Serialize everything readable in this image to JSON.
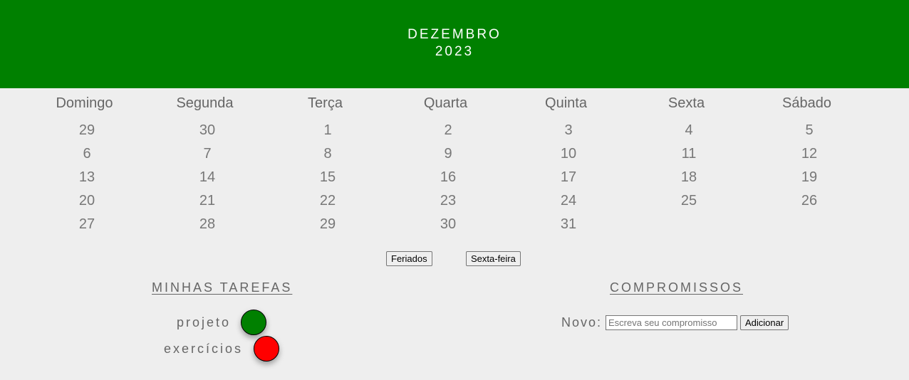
{
  "header": {
    "month": "DEZEMBRO",
    "year": "2023",
    "color": "#008000"
  },
  "calendar": {
    "weekdays": [
      "Domingo",
      "Segunda",
      "Terça",
      "Quarta",
      "Quinta",
      "Sexta",
      "Sábado"
    ],
    "weeks": [
      [
        "29",
        "30",
        "1",
        "2",
        "3",
        "4",
        "5"
      ],
      [
        "6",
        "7",
        "8",
        "9",
        "10",
        "11",
        "12"
      ],
      [
        "13",
        "14",
        "15",
        "16",
        "17",
        "18",
        "19"
      ],
      [
        "20",
        "21",
        "22",
        "23",
        "24",
        "25",
        "26"
      ],
      [
        "27",
        "28",
        "29",
        "30",
        "31",
        "",
        ""
      ]
    ]
  },
  "buttons": {
    "holidays": "Feriados",
    "friday": "Sexta-feira"
  },
  "tasks": {
    "title": "MINHAS TAREFAS",
    "items": [
      {
        "label": "projeto",
        "color": "#008000"
      },
      {
        "label": "exercícios",
        "color": "#ff0000"
      }
    ]
  },
  "appointments": {
    "title": "COMPROMISSOS",
    "new_label": "Novo:",
    "input_placeholder": "Escreva seu compromisso",
    "input_value": "",
    "add_label": "Adicionar"
  }
}
